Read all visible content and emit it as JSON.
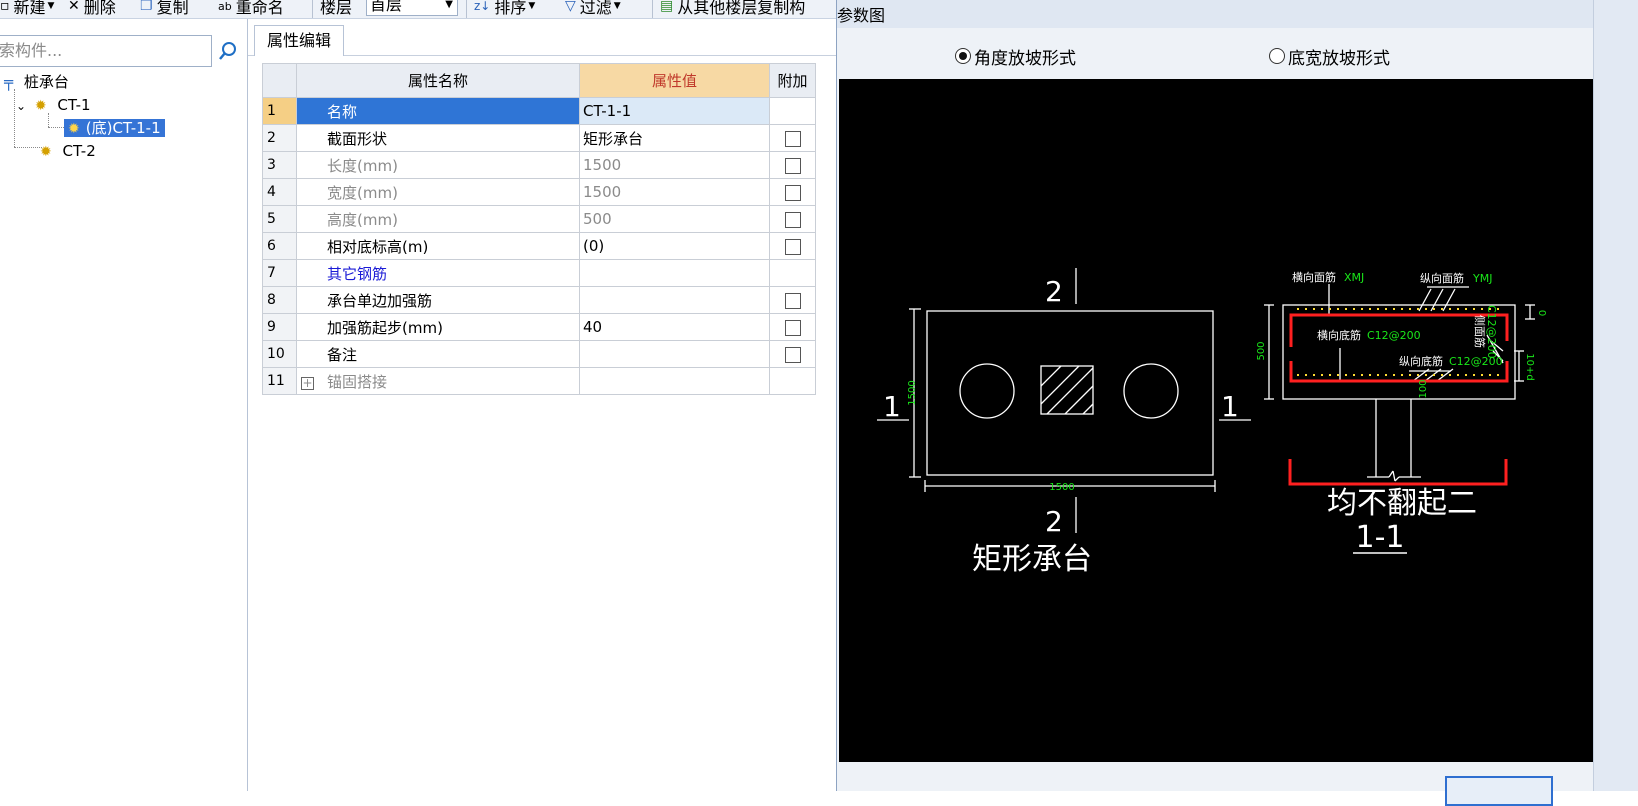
{
  "toolbar": {
    "new_label": "新建",
    "delete_label": "删除",
    "copy_label": "复制",
    "rename_label": "重命名",
    "floor_label": "楼层",
    "floor_value": "首层",
    "sort_label": "排序",
    "filter_label": "过滤",
    "copy_from_floor_label": "从其他楼层复制构"
  },
  "search": {
    "placeholder": "索构件..."
  },
  "tree": {
    "root": "桩承台",
    "nodes": [
      {
        "label": "CT-1"
      },
      {
        "label": "(底)CT-1-1"
      },
      {
        "label": "CT-2"
      }
    ]
  },
  "property_editor": {
    "tab": "属性编辑",
    "columns": {
      "name": "属性名称",
      "value": "属性值",
      "extra": "附加"
    },
    "rows": [
      {
        "num": "1",
        "name": "名称",
        "value": "CT-1-1",
        "checkbox": false
      },
      {
        "num": "2",
        "name": "截面形状",
        "value": "矩形承台",
        "checkbox": true
      },
      {
        "num": "3",
        "name": "长度(mm)",
        "value": "1500",
        "checkbox": true
      },
      {
        "num": "4",
        "name": "宽度(mm)",
        "value": "1500",
        "checkbox": true
      },
      {
        "num": "5",
        "name": "高度(mm)",
        "value": "500",
        "checkbox": true
      },
      {
        "num": "6",
        "name": "相对底标高(m)",
        "value": "(0)",
        "checkbox": true
      },
      {
        "num": "7",
        "name": "其它钢筋",
        "value": "",
        "checkbox": false
      },
      {
        "num": "8",
        "name": "承台单边加强筋",
        "value": "",
        "checkbox": true
      },
      {
        "num": "9",
        "name": "加强筋起步(mm)",
        "value": "40",
        "checkbox": true
      },
      {
        "num": "10",
        "name": "备注",
        "value": "",
        "checkbox": true
      },
      {
        "num": "11",
        "name": "锚固搭接",
        "value": "",
        "checkbox": false
      }
    ]
  },
  "dialog": {
    "title": "参数图",
    "option_angle": "角度放坡形式",
    "option_width": "底宽放坡形式",
    "diagram": {
      "plan_title": "矩形承台",
      "section_mark": "2",
      "side_mark": "1",
      "length_dim": "1500",
      "width_dim": "1500",
      "height_dim": "500",
      "label_top_h": "横向面筋",
      "label_top_h_code": "XMJ",
      "label_top_v": "纵向面筋",
      "label_top_v_code": "YMJ",
      "label_bot_h": "横向底筋",
      "label_bot_h_code": "C12@200",
      "label_bot_v": "纵向底筋",
      "label_bot_v_code": "C12@200",
      "label_side": "侧面筋",
      "label_side_code": "C12@200",
      "dim_top": "0",
      "dim_side": "10+d",
      "dim_bottom": "100",
      "note": "均不翻起二",
      "section_title": "1-1"
    }
  },
  "colors": {
    "selection": "#2f75d6",
    "header_value": "#f7d9a4",
    "cad_green": "#19e619",
    "cad_red": "#ff2020"
  }
}
